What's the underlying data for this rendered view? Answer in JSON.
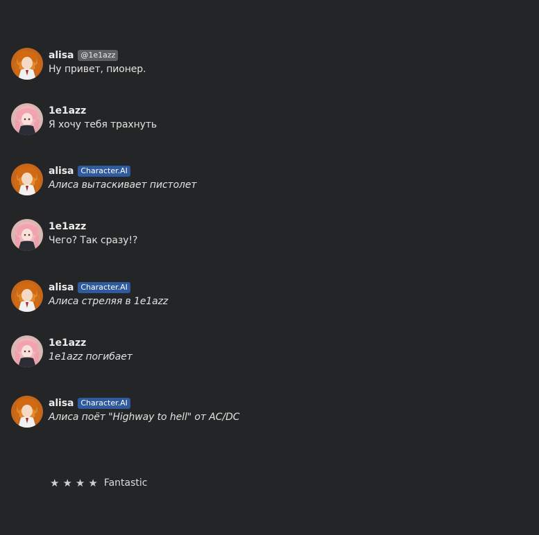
{
  "messages": [
    {
      "author": "alisa",
      "badge": "@1e1azz",
      "badge_type": "handle",
      "avatar": "alisa-avatar",
      "text": "Ну привет, пионер.",
      "italic": false
    },
    {
      "author": "1e1azz",
      "badge": "",
      "badge_type": "",
      "avatar": "user-avatar",
      "text": "Я хочу тебя трахнуть",
      "italic": false
    },
    {
      "author": "alisa",
      "badge": "Character.AI",
      "badge_type": "ai",
      "avatar": "alisa-avatar",
      "text": "Алиса вытаскивает пистолет",
      "italic": true
    },
    {
      "author": "1e1azz",
      "badge": "",
      "badge_type": "",
      "avatar": "user-avatar",
      "text": "Чего? Так сразу!?",
      "italic": false
    },
    {
      "author": "alisa",
      "badge": "Character.AI",
      "badge_type": "ai",
      "avatar": "alisa-avatar",
      "text": "Алиса стреляя в 1e1azz",
      "italic": true
    },
    {
      "author": "1e1azz",
      "badge": "",
      "badge_type": "",
      "avatar": "user-avatar",
      "text": "1e1azz погибает",
      "italic": true
    },
    {
      "author": "alisa",
      "badge": "Character.AI",
      "badge_type": "ai",
      "avatar": "alisa-avatar",
      "text": "Алиса поёт \"Highway to hell\" от AC/DC",
      "italic": true
    }
  ],
  "rating": {
    "stars_filled": 4,
    "star_glyph": "★",
    "label": "Fantastic"
  },
  "colors": {
    "background": "#242526",
    "handle_badge": "#5f6061",
    "ai_badge": "#2f5a9e"
  }
}
